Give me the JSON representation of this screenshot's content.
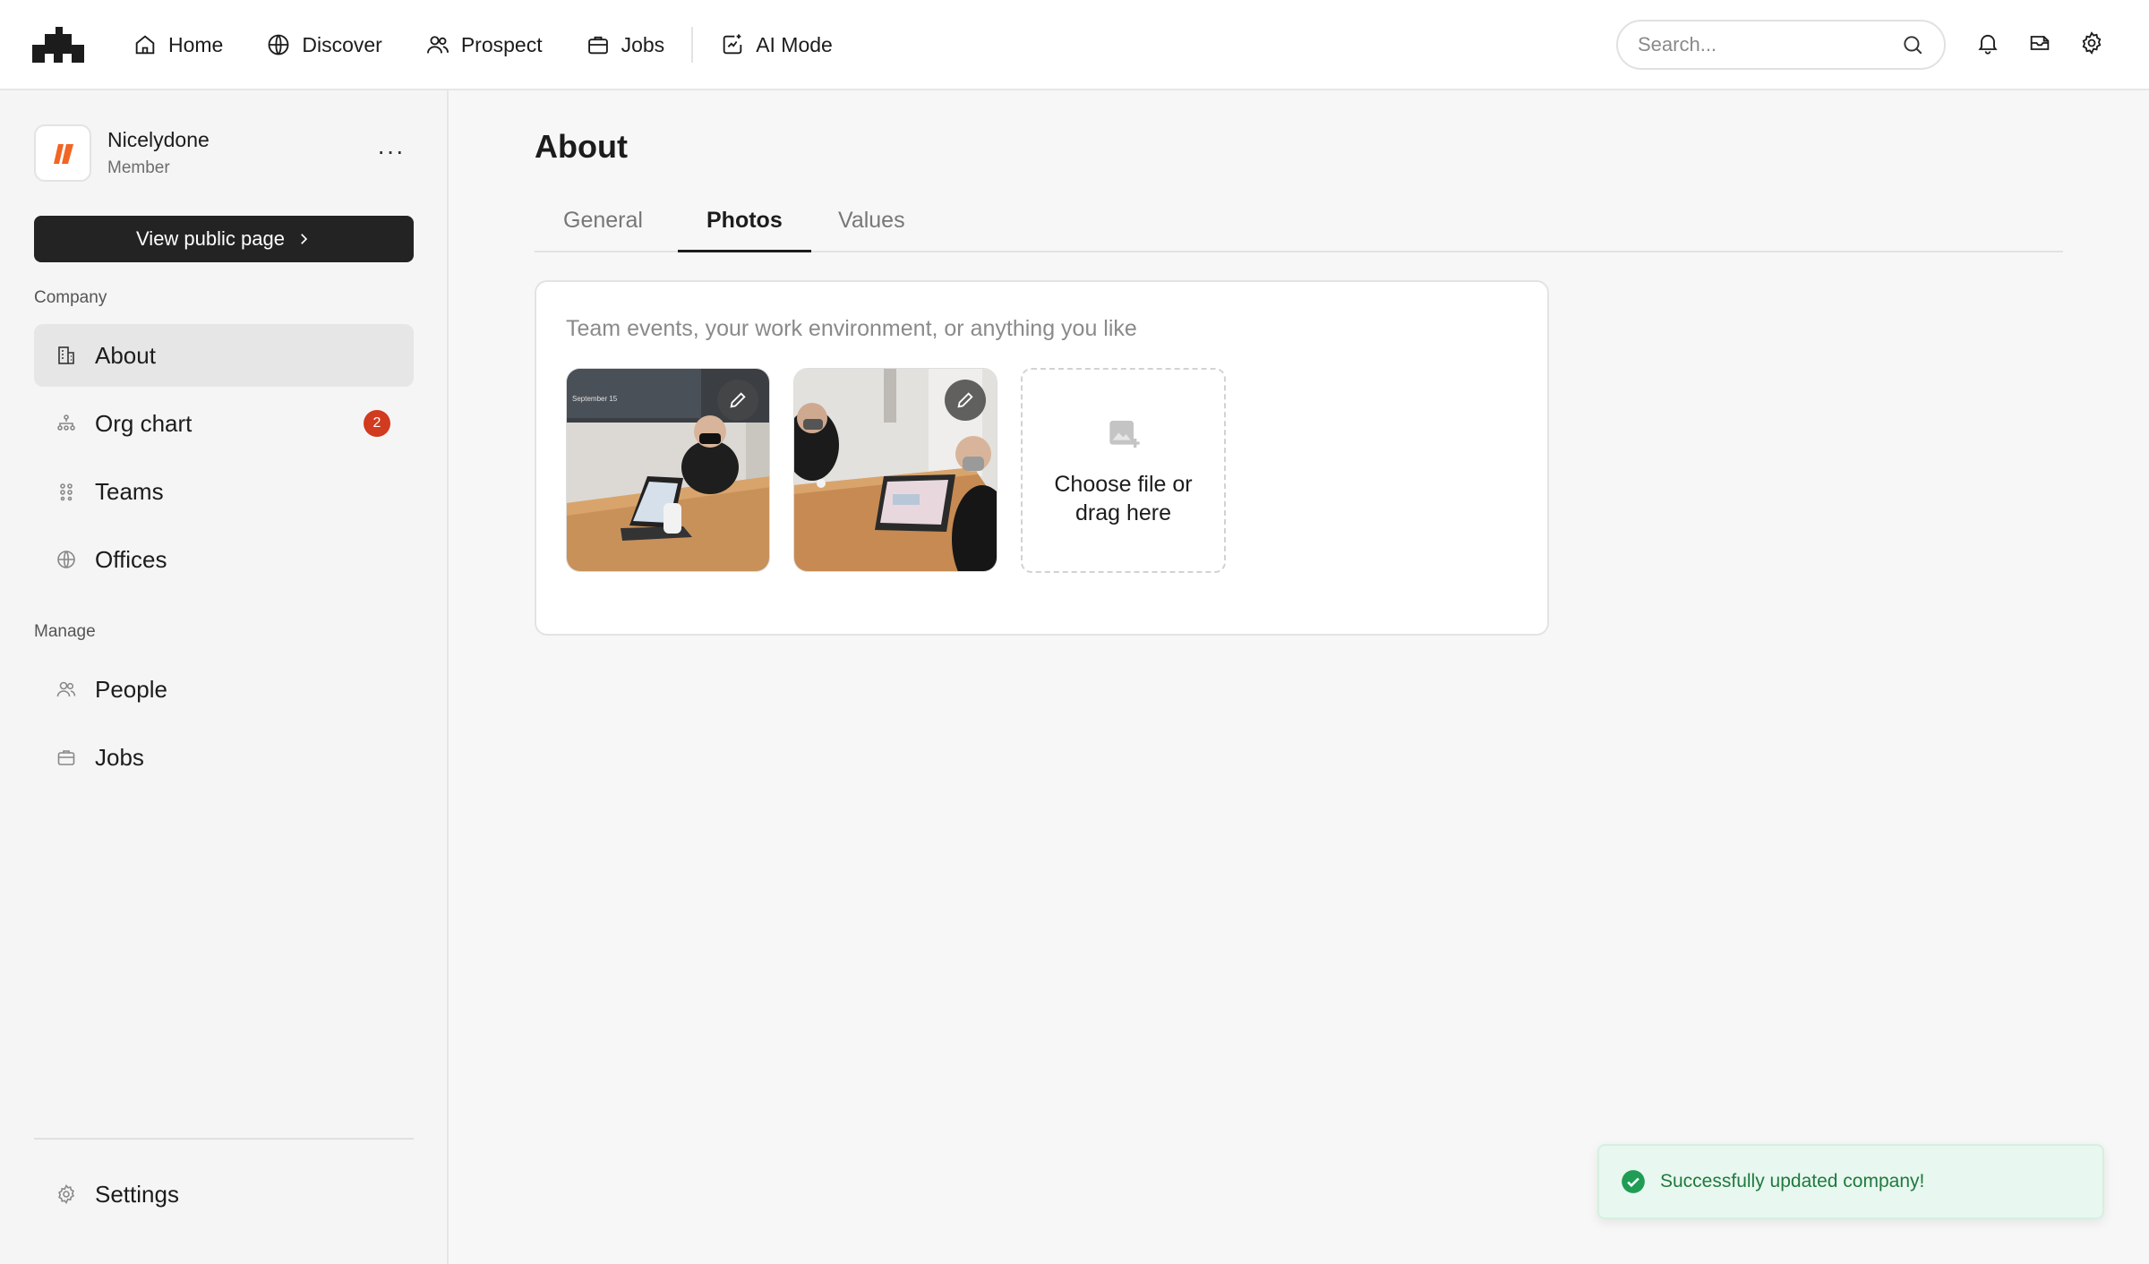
{
  "topnav": {
    "items": [
      {
        "label": "Home",
        "icon": "home-icon"
      },
      {
        "label": "Discover",
        "icon": "globe-icon"
      },
      {
        "label": "Prospect",
        "icon": "users-icon"
      },
      {
        "label": "Jobs",
        "icon": "briefcase-icon"
      },
      {
        "label": "AI Mode",
        "icon": "ai-mode-icon"
      }
    ],
    "search_placeholder": "Search..."
  },
  "sidebar": {
    "company_name": "Nicelydone",
    "company_role": "Member",
    "more_label": "···",
    "public_button": "View public page",
    "section_company": "Company",
    "section_manage": "Manage",
    "company_items": [
      {
        "label": "About",
        "icon": "building-icon",
        "active": true
      },
      {
        "label": "Org chart",
        "icon": "org-chart-icon",
        "badge": "2"
      },
      {
        "label": "Teams",
        "icon": "teams-icon"
      },
      {
        "label": "Offices",
        "icon": "globe-icon"
      }
    ],
    "manage_items": [
      {
        "label": "People",
        "icon": "users-icon"
      },
      {
        "label": "Jobs",
        "icon": "briefcase-icon"
      }
    ],
    "settings_label": "Settings"
  },
  "main": {
    "title": "About",
    "tabs": [
      {
        "label": "General",
        "active": false
      },
      {
        "label": "Photos",
        "active": true
      },
      {
        "label": "Values",
        "active": false
      }
    ],
    "hint": "Team events, your work environment, or anything you like",
    "photo_caption": "September 15",
    "dropzone_text": "Choose file or drag here"
  },
  "toast": {
    "message": "Successfully updated company!"
  },
  "colors": {
    "accent_dark": "#232323",
    "badge": "#d13b1f",
    "toast_bg": "#e8f7ef",
    "toast_text": "#1f7a3e",
    "brand_orange": "#f26522"
  }
}
